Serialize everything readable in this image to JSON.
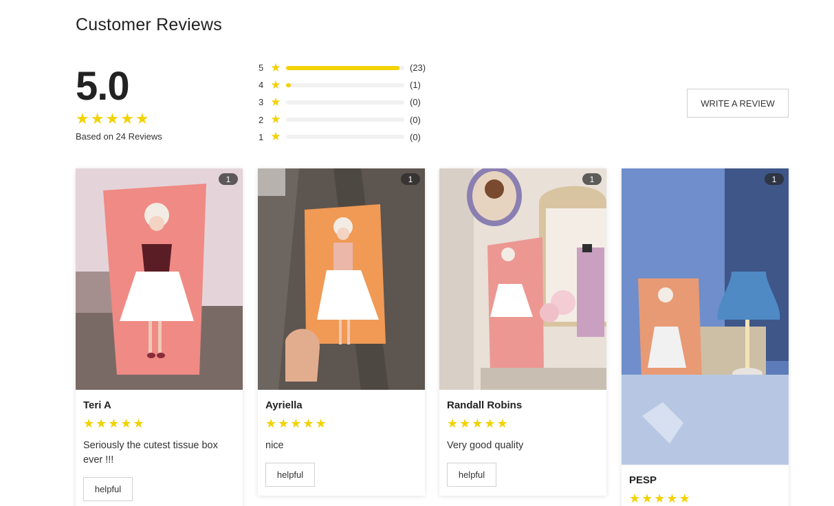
{
  "page_title": "Customer Reviews",
  "summary": {
    "average": "5.0",
    "average_value": 5.0,
    "based_on": "Based on 24 Reviews"
  },
  "star_glyph": "★",
  "star_color": "#f2d200",
  "histogram": [
    {
      "stars": "5",
      "count": "(23)",
      "share": 0.958
    },
    {
      "stars": "4",
      "count": "(1)",
      "share": 0.042
    },
    {
      "stars": "3",
      "count": "(0)",
      "share": 0
    },
    {
      "stars": "2",
      "count": "(0)",
      "share": 0
    },
    {
      "stars": "1",
      "count": "(0)",
      "share": 0
    }
  ],
  "write_review_label": "WRITE A REVIEW",
  "reviews": [
    {
      "name": "Teri A",
      "rating": 5,
      "text": "Seriously the cutest tissue box ever !!!",
      "photo_count": "1",
      "helpful_label": "helpful",
      "photo_icon": "pink-tissue-box-photo"
    },
    {
      "name": "Ayriella",
      "rating": 5,
      "text": "nice",
      "photo_count": "1",
      "helpful_label": "helpful",
      "photo_icon": "orange-tissue-box-photo"
    },
    {
      "name": "Randall Robins",
      "rating": 5,
      "text": "Very good quality",
      "photo_count": "1",
      "helpful_label": "helpful",
      "photo_icon": "tissue-box-on-vanity-photo"
    },
    {
      "name": "PESP",
      "rating": 5,
      "text": "",
      "photo_count": "1",
      "helpful_label": "",
      "photo_icon": "tissue-box-with-lamp-photo"
    }
  ]
}
